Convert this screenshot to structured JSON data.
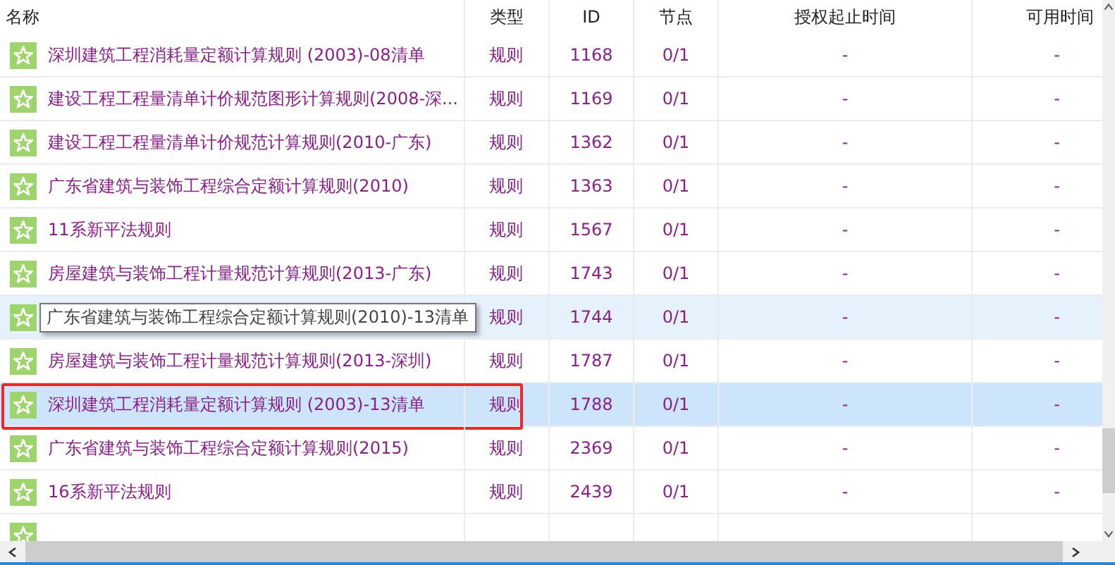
{
  "table": {
    "columns": [
      "名称",
      "类型",
      "ID",
      "节点",
      "授权起止时间",
      "可用时间"
    ],
    "rows": [
      {
        "name": "深圳建筑工程消耗量定额计算规则 (2003)-08清单",
        "type": "规则",
        "id": "1168",
        "nodes": "0/1",
        "auth_period": "-",
        "available_time": "-",
        "selected": false,
        "hovered": false,
        "outlined": false
      },
      {
        "name": "建设工程工程量清单计价规范图形计算规则(2008-深...",
        "type": "规则",
        "id": "1169",
        "nodes": "0/1",
        "auth_period": "-",
        "available_time": "-",
        "selected": false,
        "hovered": false,
        "outlined": false
      },
      {
        "name": "建设工程工程量清单计价规范计算规则(2010-广东)",
        "type": "规则",
        "id": "1362",
        "nodes": "0/1",
        "auth_period": "-",
        "available_time": "-",
        "selected": false,
        "hovered": false,
        "outlined": false
      },
      {
        "name": "广东省建筑与装饰工程综合定额计算规则(2010)",
        "type": "规则",
        "id": "1363",
        "nodes": "0/1",
        "auth_period": "-",
        "available_time": "-",
        "selected": false,
        "hovered": false,
        "outlined": false
      },
      {
        "name": "11系新平法规则",
        "type": "规则",
        "id": "1567",
        "nodes": "0/1",
        "auth_period": "-",
        "available_time": "-",
        "selected": false,
        "hovered": false,
        "outlined": false
      },
      {
        "name": "房屋建筑与装饰工程计量规范计算规则(2013-广东)",
        "type": "规则",
        "id": "1743",
        "nodes": "0/1",
        "auth_period": "-",
        "available_time": "-",
        "selected": false,
        "hovered": false,
        "outlined": false
      },
      {
        "tooltip": "广东省建筑与装饰工程综合定额计算规则(2010)-13清单",
        "type": "规则",
        "id": "1744",
        "nodes": "0/1",
        "auth_period": "-",
        "available_time": "-",
        "selected": false,
        "hovered": true,
        "outlined": false
      },
      {
        "name": "房屋建筑与装饰工程计量规范计算规则(2013-深圳)",
        "type": "规则",
        "id": "1787",
        "nodes": "0/1",
        "auth_period": "-",
        "available_time": "-",
        "selected": false,
        "hovered": false,
        "outlined": false
      },
      {
        "name": "深圳建筑工程消耗量定额计算规则 (2003)-13清单",
        "type": "规则",
        "id": "1788",
        "nodes": "0/1",
        "auth_period": "-",
        "available_time": "-",
        "selected": true,
        "hovered": false,
        "outlined": true
      },
      {
        "name": "广东省建筑与装饰工程综合定额计算规则(2015)",
        "type": "规则",
        "id": "2369",
        "nodes": "0/1",
        "auth_period": "-",
        "available_time": "-",
        "selected": false,
        "hovered": false,
        "outlined": false
      },
      {
        "name": "16系新平法规则",
        "type": "规则",
        "id": "2439",
        "nodes": "0/1",
        "auth_period": "-",
        "available_time": "-",
        "selected": false,
        "hovered": false,
        "outlined": false
      },
      {
        "selected": false,
        "hovered": false,
        "outlined": false
      }
    ]
  }
}
